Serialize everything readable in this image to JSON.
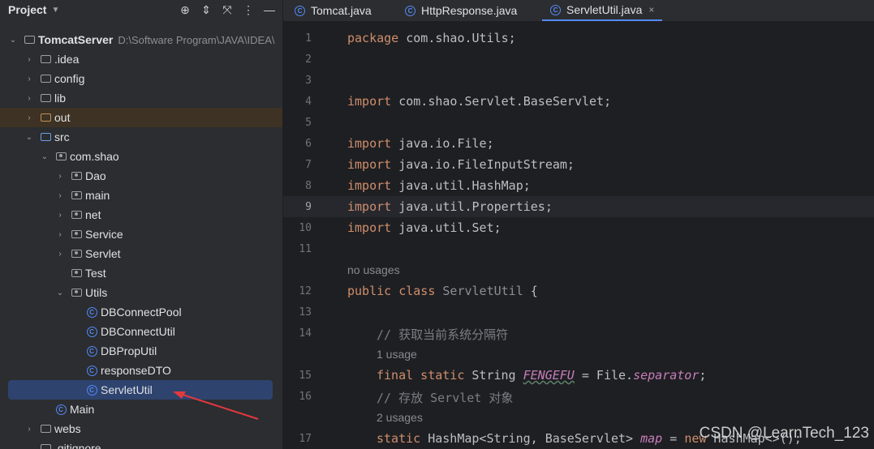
{
  "project_panel": {
    "title": "Project",
    "root": {
      "name": "TomcatServer",
      "path": "D:\\Software Program\\JAVA\\IDEA\\"
    },
    "items": [
      {
        "label": ".idea",
        "icon": "folder-icon"
      },
      {
        "label": "config",
        "icon": "folder-icon"
      },
      {
        "label": "lib",
        "icon": "folder-icon"
      },
      {
        "label": "out",
        "icon": "folder-icon"
      },
      {
        "label": "src",
        "icon": "folder-icon"
      },
      {
        "label": "com.shao",
        "icon": "package-icon"
      },
      {
        "label": "Dao",
        "icon": "package-icon"
      },
      {
        "label": "main",
        "icon": "package-icon"
      },
      {
        "label": "net",
        "icon": "package-icon"
      },
      {
        "label": "Service",
        "icon": "package-icon"
      },
      {
        "label": "Servlet",
        "icon": "package-icon"
      },
      {
        "label": "Test",
        "icon": "package-icon"
      },
      {
        "label": "Utils",
        "icon": "package-icon"
      },
      {
        "label": "DBConnectPool",
        "icon": "class-icon"
      },
      {
        "label": "DBConnectUtil",
        "icon": "class-icon"
      },
      {
        "label": "DBPropUtil",
        "icon": "class-icon"
      },
      {
        "label": "responseDTO",
        "icon": "class-icon"
      },
      {
        "label": "ServletUtil",
        "icon": "class-icon"
      },
      {
        "label": "Main",
        "icon": "class-icon"
      },
      {
        "label": "webs",
        "icon": "folder-icon"
      },
      {
        "label": ".gitignore",
        "icon": "file-icon"
      }
    ]
  },
  "tabs": [
    {
      "label": "Tomcat.java"
    },
    {
      "label": "HttpResponse.java"
    },
    {
      "label": "ServletUtil.java",
      "close": "×"
    }
  ],
  "editor": {
    "line_numbers": [
      "1",
      "2",
      "3",
      "4",
      "5",
      "6",
      "7",
      "8",
      "9",
      "10",
      "11",
      "12",
      "13",
      "14",
      "15",
      "16",
      "17"
    ],
    "hints": {
      "no_usages": "no usages",
      "one_usage": "1 usage",
      "two_usages": "2 usages"
    },
    "code": {
      "l1_kw": "package",
      "l1_rest": " com.shao.Utils;",
      "l4_kw": "import",
      "l4_rest": " com.shao.Servlet.BaseServlet;",
      "l6_kw": "import",
      "l6_rest": " java.io.File;",
      "l7_kw": "import",
      "l7_rest": " java.io.FileInputStream;",
      "l8_kw": "import",
      "l8_rest": " java.util.HashMap;",
      "l9_kw": "import",
      "l9_rest": " java.util.Properties;",
      "l10_kw": "import",
      "l10_rest": " java.util.Set;",
      "l12_kw": "public class",
      "l12_name": " ServletUtil",
      "l12_rest": " {",
      "l14_comment": "// 获取当前系统分隔符",
      "l15_kw": "final static",
      "l15_type": " String ",
      "l15_field": "FENGEFU",
      "l15_mid": " = File.",
      "l15_sep": "separator",
      "l15_end": ";",
      "l16_comment": "// 存放 Servlet 对象",
      "l17_kw": "static",
      "l17_type": " HashMap<String, BaseServlet> ",
      "l17_field": "map",
      "l17_mid": " = ",
      "l17_new": "new",
      "l17_end": " HashMap<>();"
    },
    "current_line": "9"
  },
  "watermark": "CSDN @LearnTech_123",
  "colors": {
    "selection": "#2e436e",
    "keyword": "#cf8e6d",
    "arrow": "#e0393e"
  }
}
